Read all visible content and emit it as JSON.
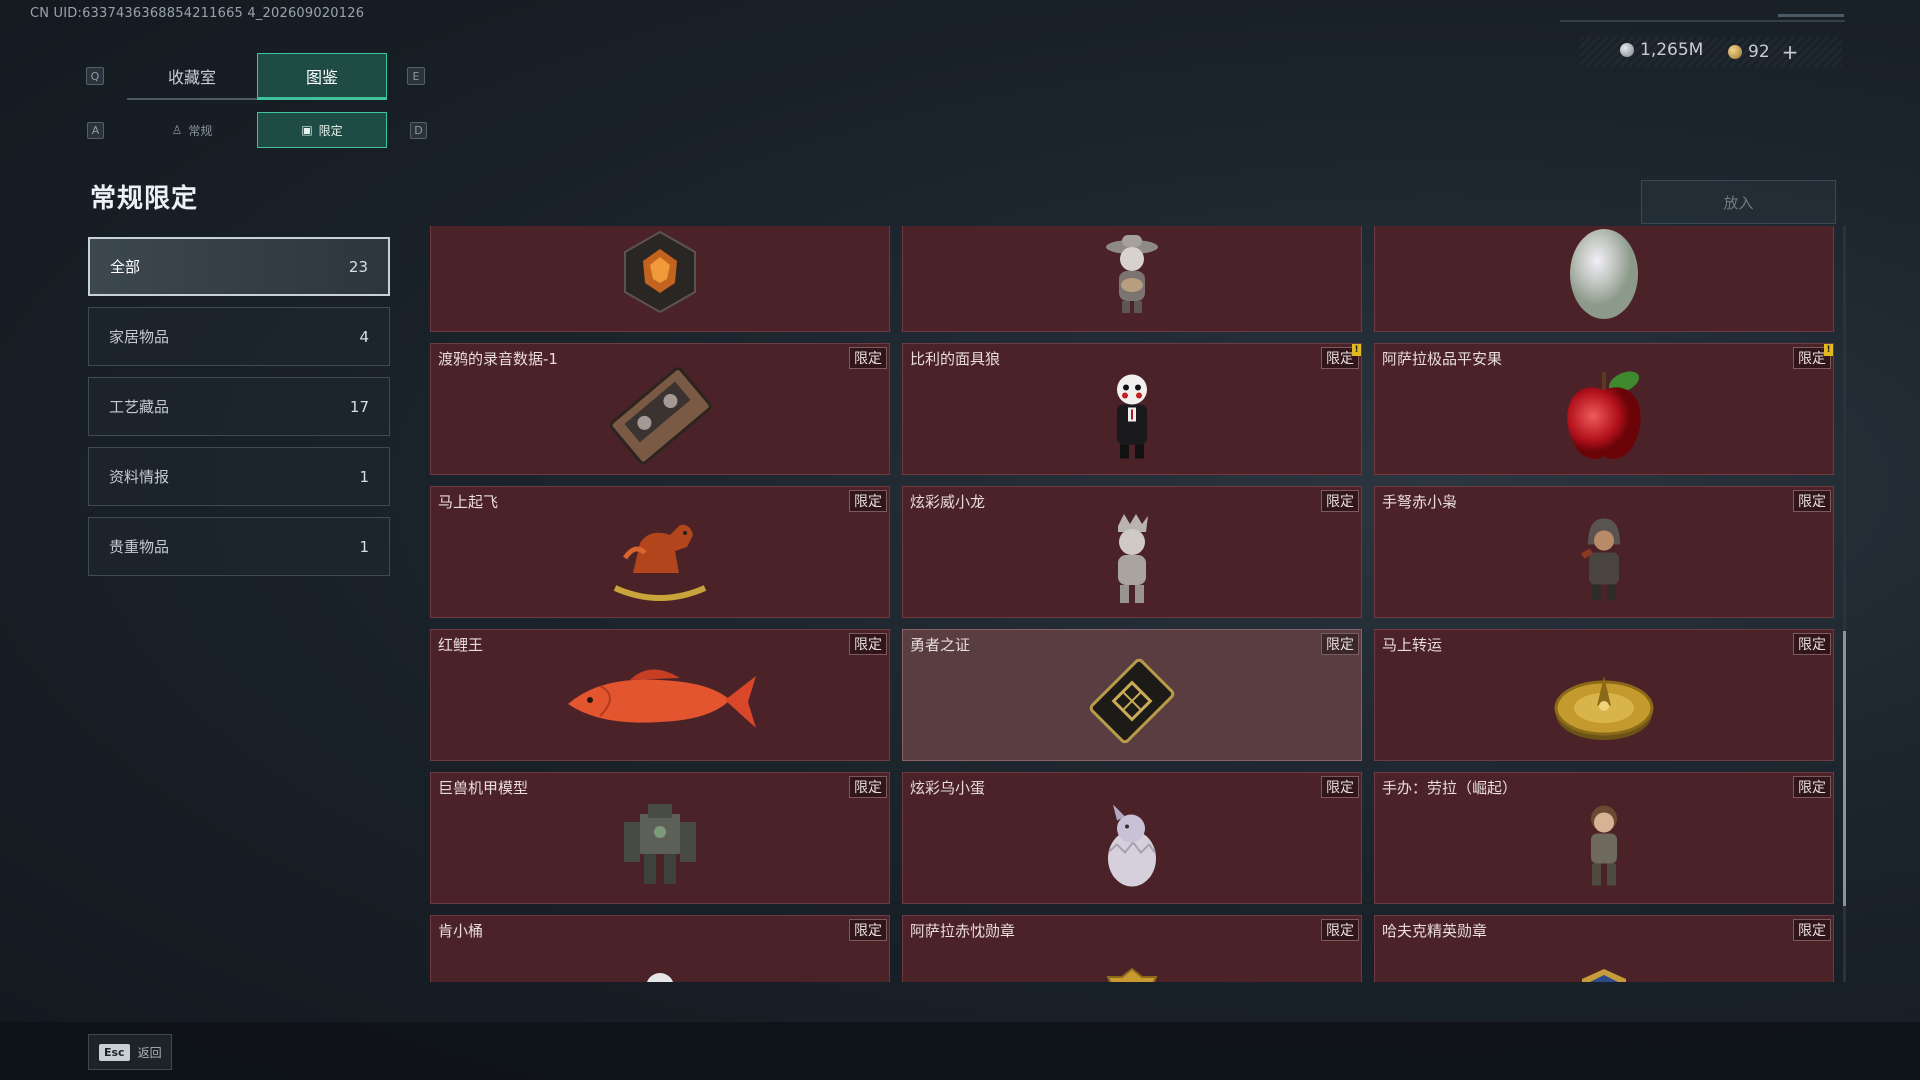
{
  "uid": "CN UID:6337436368854211665 4_202609020126",
  "header": {
    "key_left": "Q",
    "key_right": "E",
    "tabs": [
      {
        "label": "收藏室"
      },
      {
        "label": "图鉴"
      }
    ],
    "active_tab": 1,
    "subkey_left": "A",
    "subkey_right": "D",
    "subtabs": [
      {
        "label": "常规"
      },
      {
        "label": "限定"
      }
    ],
    "active_subtab": 1
  },
  "currency": {
    "silver": "1,265M",
    "gold": "92",
    "add_label": "+"
  },
  "section_title": "常规限定",
  "put_in_label": "放入",
  "categories": [
    {
      "label": "全部",
      "count": "23"
    },
    {
      "label": "家居物品",
      "count": "4"
    },
    {
      "label": "工艺藏品",
      "count": "17"
    },
    {
      "label": "资料情报",
      "count": "1"
    },
    {
      "label": "贵重物品",
      "count": "1"
    }
  ],
  "tag_label": "限定",
  "items": [
    {
      "name": "",
      "icon": "dark-crystal-icon",
      "warn": false
    },
    {
      "name": "",
      "icon": "mariachi-figure-icon",
      "warn": false
    },
    {
      "name": "",
      "icon": "pearl-egg-icon",
      "warn": false
    },
    {
      "name": "渡鸦的录音数据-1",
      "icon": "cassette-tape-icon",
      "warn": false
    },
    {
      "name": "比利的面具狼",
      "icon": "puppet-figure-icon",
      "warn": true
    },
    {
      "name": "阿萨拉极品平安果",
      "icon": "red-apple-icon",
      "warn": true
    },
    {
      "name": "马上起飞",
      "icon": "rocking-horse-icon",
      "warn": false
    },
    {
      "name": "炫彩威小龙",
      "icon": "silver-figure-icon",
      "warn": false
    },
    {
      "name": "手弩赤小枭",
      "icon": "hooded-figure-icon",
      "warn": false
    },
    {
      "name": "红鲤王",
      "icon": "red-carp-icon",
      "warn": false
    },
    {
      "name": "勇者之证",
      "icon": "card-token-icon",
      "warn": false
    },
    {
      "name": "马上转运",
      "icon": "gold-compass-icon",
      "warn": false
    },
    {
      "name": "巨兽机甲模型",
      "icon": "mech-model-icon",
      "warn": false
    },
    {
      "name": "炫彩乌小蛋",
      "icon": "egg-figure-icon",
      "warn": false
    },
    {
      "name": "手办：劳拉（崛起）",
      "icon": "lara-figure-icon",
      "warn": false
    },
    {
      "name": "肯小桶",
      "icon": "bust-figure-icon",
      "warn": false
    },
    {
      "name": "阿萨拉赤忱勋章",
      "icon": "gold-medal-icon",
      "warn": false
    },
    {
      "name": "哈夫克精英勋章",
      "icon": "blue-medal-icon",
      "warn": false
    }
  ],
  "highlighted_item": 10,
  "footer": {
    "esc_key": "Esc",
    "back_label": "返回"
  },
  "colors": {
    "accent": "#3ec39a",
    "card_bg": "#4b2228",
    "warn": "#e2b91f"
  }
}
